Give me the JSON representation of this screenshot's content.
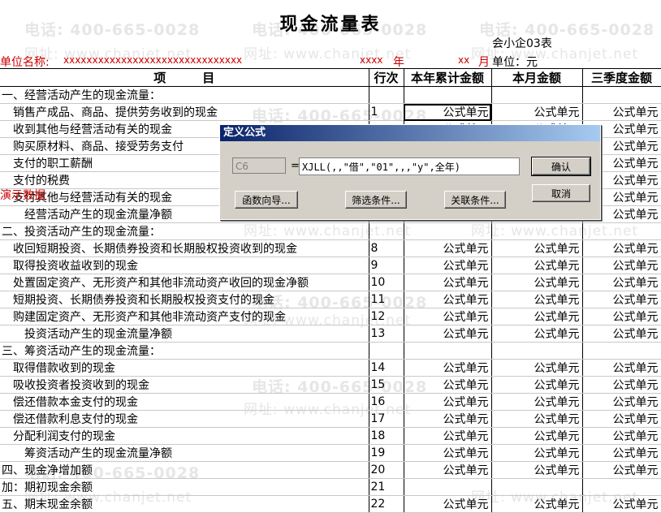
{
  "title": "现金流量表",
  "form_code": "会小企03表",
  "unit_name_label": "单位名称:",
  "unit_name_value": "xxxxxxxxxxxxxxxxxxxxxxxxxxxxxxx",
  "year_value": "xxxx",
  "year_label": "年",
  "month_value": "xx",
  "month_label": "月",
  "currency_unit": "单位：元",
  "demo_label": "演示数据",
  "headers": {
    "item": "项　　　目",
    "row": "行次",
    "ytd": "本年累计金额",
    "month": "本月金额",
    "q3": "三季度金额"
  },
  "rows": [
    {
      "item": "一、经营活动产生的现金流量：",
      "row": "",
      "ytd": "",
      "month": "",
      "q3": ""
    },
    {
      "item": "　销售产成品、商品、提供劳务收到的现金",
      "row": "1",
      "ytd": "公式单元",
      "month": "公式单元",
      "q3": "公式单元"
    },
    {
      "item": "　收到其他与经营活动有关的现金",
      "row": "",
      "ytd": "公式单元",
      "month": "公式单元",
      "q3": "公式单元"
    },
    {
      "item": "　购买原材料、商品、接受劳务支付",
      "row": "",
      "ytd": "",
      "month": "",
      "q3": "公式单元"
    },
    {
      "item": "　支付的职工薪酬",
      "row": "",
      "ytd": "",
      "month": "",
      "q3": "公式单元"
    },
    {
      "item": "　支付的税费",
      "row": "",
      "ytd": "",
      "month": "",
      "q3": "公式单元"
    },
    {
      "item": "　支付其他与经营活动有关的现金",
      "row": "",
      "ytd": "",
      "month": "",
      "q3": "公式单元"
    },
    {
      "item": "　　经营活动产生的现金流量净额",
      "row": "",
      "ytd": "",
      "month": "",
      "q3": "公式单元"
    },
    {
      "item": "二、投资活动产生的现金流量：",
      "row": "",
      "ytd": "",
      "month": "",
      "q3": ""
    },
    {
      "item": "　收回短期投资、长期债券投资和长期股权投资收到的现金",
      "row": "8",
      "ytd": "公式单元",
      "month": "公式单元",
      "q3": "公式单元"
    },
    {
      "item": "　取得投资收益收到的现金",
      "row": "9",
      "ytd": "公式单元",
      "month": "公式单元",
      "q3": "公式单元"
    },
    {
      "item": "　处置固定资产、无形资产和其他非流动资产收回的现金净额",
      "row": "10",
      "ytd": "公式单元",
      "month": "公式单元",
      "q3": "公式单元"
    },
    {
      "item": "　短期投资、长期债券投资和长期股权投资支付的现金",
      "row": "11",
      "ytd": "公式单元",
      "month": "公式单元",
      "q3": "公式单元"
    },
    {
      "item": "　购建固定资产、无形资产和其他非流动资产支付的现金",
      "row": "12",
      "ytd": "公式单元",
      "month": "公式单元",
      "q3": "公式单元"
    },
    {
      "item": "　　投资活动产生的现金流量净额",
      "row": "13",
      "ytd": "公式单元",
      "month": "公式单元",
      "q3": "公式单元"
    },
    {
      "item": "三、筹资活动产生的现金流量：",
      "row": "",
      "ytd": "",
      "month": "",
      "q3": ""
    },
    {
      "item": "　取得借款收到的现金",
      "row": "14",
      "ytd": "公式单元",
      "month": "公式单元",
      "q3": "公式单元"
    },
    {
      "item": "　吸收投资者投资收到的现金",
      "row": "15",
      "ytd": "公式单元",
      "month": "公式单元",
      "q3": "公式单元"
    },
    {
      "item": "　偿还借款本金支付的现金",
      "row": "16",
      "ytd": "公式单元",
      "month": "公式单元",
      "q3": "公式单元"
    },
    {
      "item": "　偿还借款利息支付的现金",
      "row": "17",
      "ytd": "公式单元",
      "month": "公式单元",
      "q3": "公式单元"
    },
    {
      "item": "　分配利润支付的现金",
      "row": "18",
      "ytd": "公式单元",
      "month": "公式单元",
      "q3": "公式单元"
    },
    {
      "item": "　　筹资活动产生的现金流量净额",
      "row": "19",
      "ytd": "公式单元",
      "month": "公式单元",
      "q3": "公式单元"
    },
    {
      "item": "四、现金净增加额",
      "row": "20",
      "ytd": "公式单元",
      "month": "公式单元",
      "q3": "公式单元"
    },
    {
      "item": "加：期初现金余额",
      "row": "21",
      "ytd": "",
      "month": "",
      "q3": ""
    },
    {
      "item": "五、期末现金余额",
      "row": "22",
      "ytd": "公式单元",
      "month": "公式单元",
      "q3": "公式单元"
    }
  ],
  "watermark": {
    "phone": "电话: 400-665-0028",
    "site": "网址: www.chanjet.net"
  },
  "dialog": {
    "title": "定义公式",
    "cell_ref": "C6",
    "equals": "=",
    "formula": "XJLL(,,\"借\",\"01\",,,\"y\",全年)",
    "ok_label": "确认",
    "cancel_label": "取消",
    "func_wizard_label": "函数向导...",
    "filter_label": "筛选条件...",
    "relation_label": "关联条件..."
  }
}
